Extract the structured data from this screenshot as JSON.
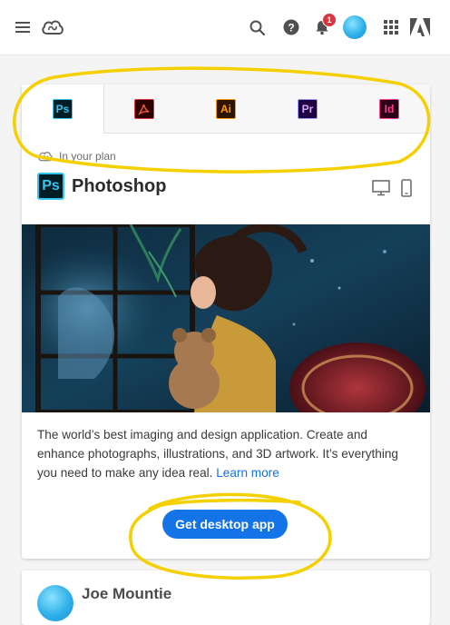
{
  "header": {
    "notification_count": "1",
    "icons": [
      "hamburger-menu-icon",
      "creative-cloud-logo-icon",
      "search-icon",
      "help-icon",
      "bell-icon",
      "avatar",
      "app-grid-icon",
      "adobe-logo-icon"
    ]
  },
  "tabs": [
    {
      "label": "Ps",
      "app": "Photoshop",
      "active": true
    },
    {
      "label": "Acrobat",
      "app": "Acrobat",
      "active": false
    },
    {
      "label": "Ai",
      "app": "Illustrator",
      "active": false
    },
    {
      "label": "Pr",
      "app": "Premiere Pro",
      "active": false
    },
    {
      "label": "Id",
      "app": "InDesign",
      "active": false
    }
  ],
  "product": {
    "plan_label": "In your plan",
    "icon_label": "Ps",
    "name": "Photoshop",
    "description": "The world’s best imaging and design application. Create and enhance photographs, illustrations, and 3D artwork. It’s everything you need to make any idea real.",
    "learn_more": "Learn more",
    "cta": "Get desktop app"
  },
  "user": {
    "name": "Joe Mountie"
  },
  "colors": {
    "accent": "#1473e6",
    "highlight": "#f5d000",
    "ps_blue": "#31c5f0"
  }
}
